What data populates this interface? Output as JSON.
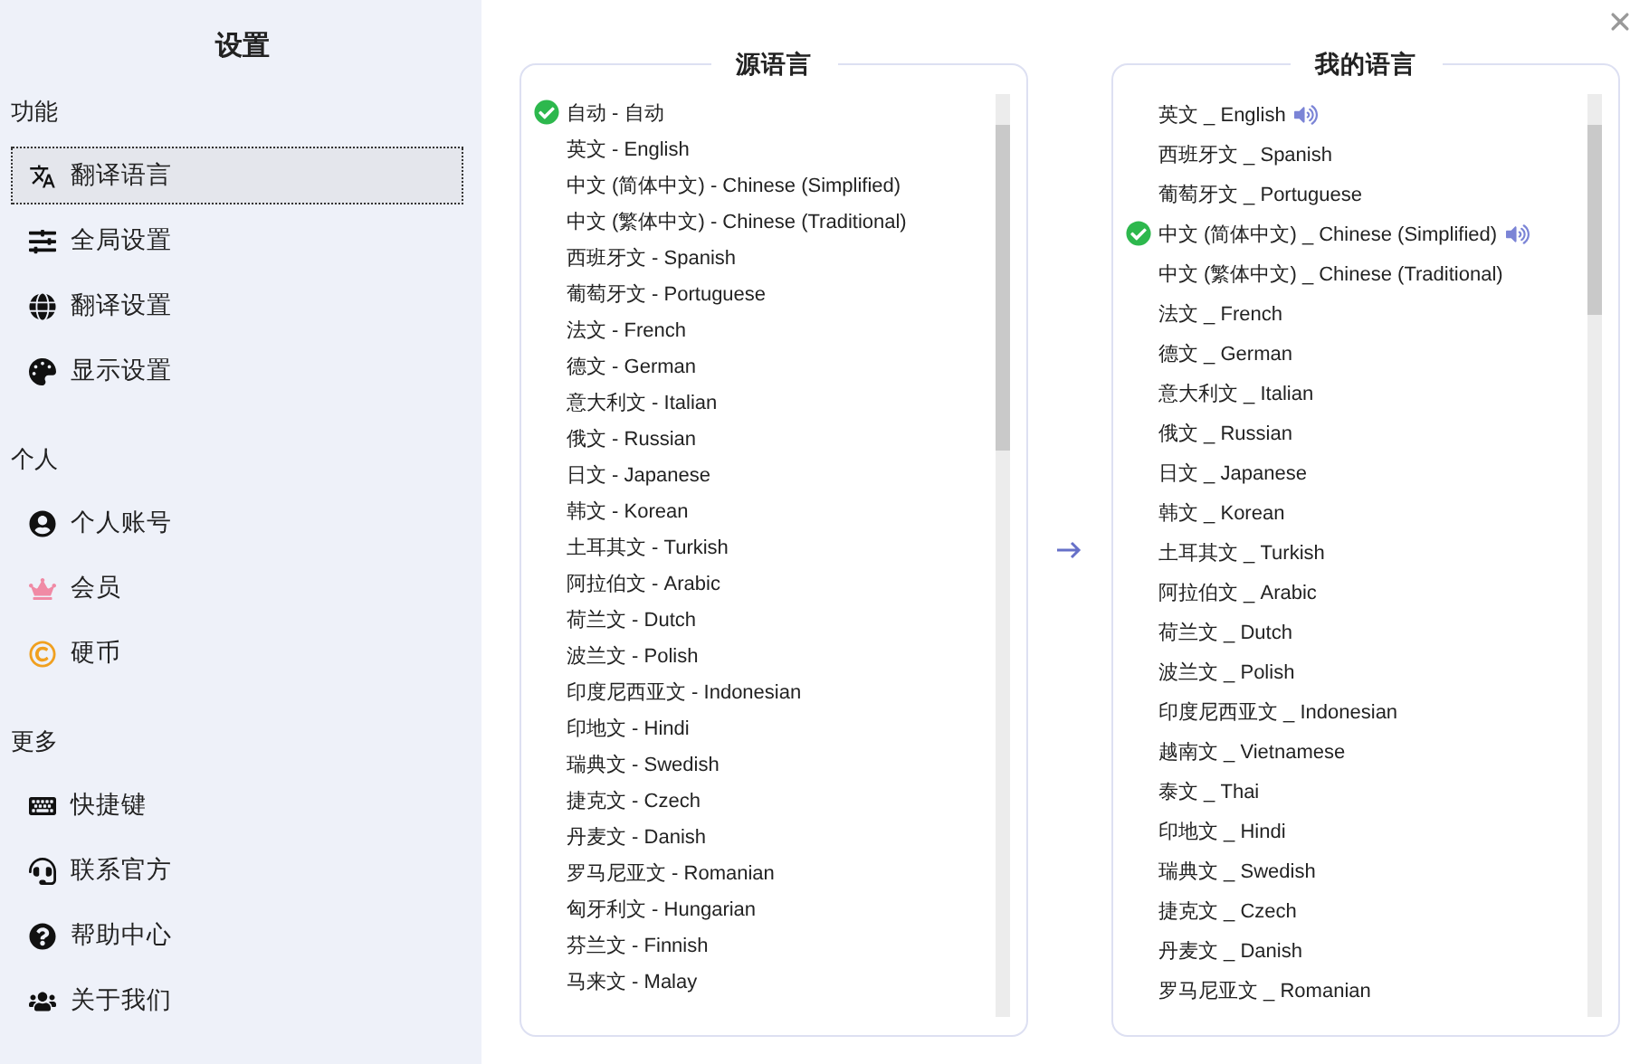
{
  "sidebar": {
    "title": "设置",
    "sections": [
      {
        "heading": "功能",
        "items": [
          {
            "label": "翻译语言",
            "selected": true
          },
          {
            "label": "全局设置",
            "selected": false
          },
          {
            "label": "翻译设置",
            "selected": false
          },
          {
            "label": "显示设置",
            "selected": false
          }
        ]
      },
      {
        "heading": "个人",
        "items": [
          {
            "label": "个人账号",
            "selected": false
          },
          {
            "label": "会员",
            "selected": false
          },
          {
            "label": "硬币",
            "selected": false
          }
        ]
      },
      {
        "heading": "更多",
        "items": [
          {
            "label": "快捷键",
            "selected": false
          },
          {
            "label": "联系官方",
            "selected": false
          },
          {
            "label": "帮助中心",
            "selected": false
          },
          {
            "label": "关于我们",
            "selected": false
          }
        ]
      }
    ]
  },
  "source_panel": {
    "title": "源语言",
    "languages": [
      {
        "label": "自动 - 自动",
        "selected": true
      },
      {
        "label": "英文 - English",
        "selected": false
      },
      {
        "label": "中文 (简体中文) - Chinese (Simplified)",
        "selected": false
      },
      {
        "label": "中文 (繁体中文) - Chinese (Traditional)",
        "selected": false
      },
      {
        "label": "西班牙文 - Spanish",
        "selected": false
      },
      {
        "label": "葡萄牙文 - Portuguese",
        "selected": false
      },
      {
        "label": "法文 - French",
        "selected": false
      },
      {
        "label": "德文 - German",
        "selected": false
      },
      {
        "label": "意大利文 - Italian",
        "selected": false
      },
      {
        "label": "俄文 - Russian",
        "selected": false
      },
      {
        "label": "日文 - Japanese",
        "selected": false
      },
      {
        "label": "韩文 - Korean",
        "selected": false
      },
      {
        "label": "土耳其文 - Turkish",
        "selected": false
      },
      {
        "label": "阿拉伯文 - Arabic",
        "selected": false
      },
      {
        "label": "荷兰文 - Dutch",
        "selected": false
      },
      {
        "label": "波兰文 - Polish",
        "selected": false
      },
      {
        "label": "印度尼西亚文 - Indonesian",
        "selected": false
      },
      {
        "label": "印地文 - Hindi",
        "selected": false
      },
      {
        "label": "瑞典文 - Swedish",
        "selected": false
      },
      {
        "label": "捷克文 - Czech",
        "selected": false
      },
      {
        "label": "丹麦文 - Danish",
        "selected": false
      },
      {
        "label": "罗马尼亚文 - Romanian",
        "selected": false
      },
      {
        "label": "匈牙利文 - Hungarian",
        "selected": false
      },
      {
        "label": "芬兰文 - Finnish",
        "selected": false
      },
      {
        "label": "马来文 - Malay",
        "selected": false
      }
    ]
  },
  "target_panel": {
    "title": "我的语言",
    "languages": [
      {
        "label": "英文 _ English",
        "selected": false,
        "speaker": true
      },
      {
        "label": "西班牙文 _ Spanish",
        "selected": false,
        "speaker": false
      },
      {
        "label": "葡萄牙文 _ Portuguese",
        "selected": false,
        "speaker": false
      },
      {
        "label": "中文 (简体中文) _ Chinese (Simplified)",
        "selected": true,
        "speaker": true
      },
      {
        "label": "中文 (繁体中文) _ Chinese (Traditional)",
        "selected": false,
        "speaker": false
      },
      {
        "label": "法文 _ French",
        "selected": false,
        "speaker": false
      },
      {
        "label": "德文 _ German",
        "selected": false,
        "speaker": false
      },
      {
        "label": "意大利文 _ Italian",
        "selected": false,
        "speaker": false
      },
      {
        "label": "俄文 _ Russian",
        "selected": false,
        "speaker": false
      },
      {
        "label": "日文 _ Japanese",
        "selected": false,
        "speaker": false
      },
      {
        "label": "韩文 _ Korean",
        "selected": false,
        "speaker": false
      },
      {
        "label": "土耳其文 _ Turkish",
        "selected": false,
        "speaker": false
      },
      {
        "label": "阿拉伯文 _ Arabic",
        "selected": false,
        "speaker": false
      },
      {
        "label": "荷兰文 _ Dutch",
        "selected": false,
        "speaker": false
      },
      {
        "label": "波兰文 _ Polish",
        "selected": false,
        "speaker": false
      },
      {
        "label": "印度尼西亚文 _ Indonesian",
        "selected": false,
        "speaker": false
      },
      {
        "label": "越南文 _ Vietnamese",
        "selected": false,
        "speaker": false
      },
      {
        "label": "泰文 _ Thai",
        "selected": false,
        "speaker": false
      },
      {
        "label": "印地文 _ Hindi",
        "selected": false,
        "speaker": false
      },
      {
        "label": "瑞典文 _ Swedish",
        "selected": false,
        "speaker": false
      },
      {
        "label": "捷克文 _ Czech",
        "selected": false,
        "speaker": false
      },
      {
        "label": "丹麦文 _ Danish",
        "selected": false,
        "speaker": false
      },
      {
        "label": "罗马尼亚文 _ Romanian",
        "selected": false,
        "speaker": false
      }
    ]
  }
}
